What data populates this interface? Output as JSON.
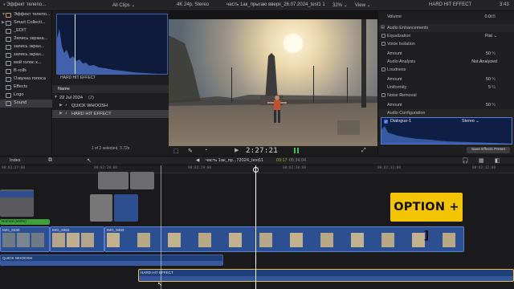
{
  "topbar": {
    "library_title": "Эффект телепо...",
    "browser_filter": "All Clips",
    "viewer_format": "4K 24p, Stereo",
    "project_name": "часть 1ак_прыгаю вверх_26.07.2024_test1 1",
    "zoom": "32%",
    "view_label": "View",
    "inspector_title": "HARD HIT EFFECT",
    "inspector_duration": "3:43"
  },
  "sidebar": {
    "items": [
      {
        "label": "Эффект телепо...",
        "expanded": true
      },
      {
        "label": "Smart Collecti..."
      },
      {
        "label": "_EDIT"
      },
      {
        "label": "Запись экрана..."
      },
      {
        "label": "запись экран..."
      },
      {
        "label": "запись экран..."
      },
      {
        "label": "мой голос к..."
      },
      {
        "label": "B-rolls"
      },
      {
        "label": "Озвучка голоса"
      },
      {
        "label": "Effects"
      },
      {
        "label": "Logo"
      },
      {
        "label": "Sound",
        "selected": true
      }
    ]
  },
  "browser": {
    "thumb_label": "HARD HIT EFFECT",
    "list_header": "Name",
    "group_label": "22 Jul 2024",
    "group_count": "(2)",
    "clips": [
      "QUICK WHOOSH",
      "HARD HIT EFFECT"
    ],
    "status": "1 of 2 selected, 3.72s"
  },
  "viewer": {
    "timecode": "2:27:21"
  },
  "inspector": {
    "volume_label": "Volume",
    "volume_value": "0.0",
    "volume_unit": "dB",
    "enhancements_label": "Audio Enhancements",
    "equalization_label": "Equalization",
    "equalization_value": "Flat",
    "voice_isolation_label": "Voice Isolation",
    "amount_label": "Amount",
    "amount1_value": "50",
    "audio_analysis_label": "Audio Analysis",
    "audio_analysis_value": "Not Analyzed",
    "loudness_label": "Loudness",
    "amount2_value": "50",
    "uniformity_label": "Uniformity",
    "uniformity_value": "5",
    "noise_removal_label": "Noise Removal",
    "amount3_value": "50",
    "percent": "%",
    "audio_config_label": "Audio Configuration",
    "dialogue_label": "Dialogue-1",
    "stereo_label": "Stereo",
    "save_preset_label": "Save Effects Preset"
  },
  "timeline": {
    "index_label": "Index",
    "project_name": "часть 1ак_пр...72024_test11",
    "time_position": "03:17",
    "time_total": "05:34:04",
    "ruler": [
      "00:02:27:00",
      "00:02:28:00",
      "00:02:29:00",
      "00:02:30:00",
      "00:02:31:00",
      "00:02:32:00"
    ],
    "clips": {
      "broll_label": "Normal (100%)",
      "primary_a": "IMG_9330",
      "primary_b": "IMG_9362",
      "primary_c": "IMG_9363",
      "audio_whoosh": "QUICK WHOOSH",
      "audio_hit": "HARD HIT EFFECT"
    }
  },
  "overlay": {
    "shortcut_text": "OPTION + ]"
  },
  "colors": {
    "accent": "#3a6fd8",
    "badge": "#f5c400",
    "audio_clip": "#1f3f7a",
    "primary_clip": "#2c4f92"
  }
}
